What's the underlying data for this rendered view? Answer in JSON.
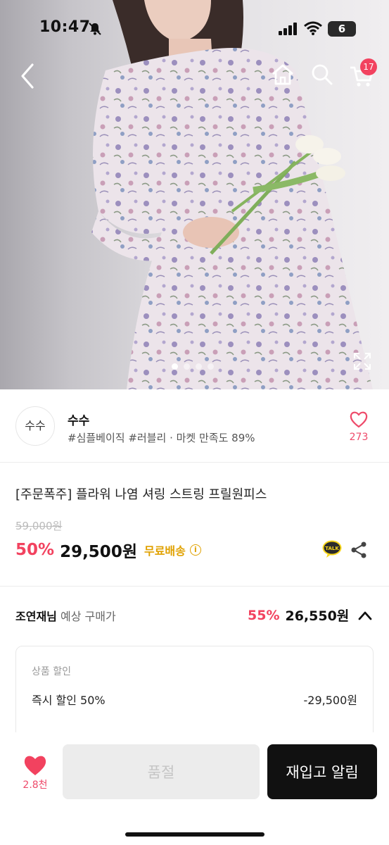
{
  "status_bar": {
    "time": "10:47",
    "battery": "6"
  },
  "nav": {
    "cart_count": "17"
  },
  "store": {
    "logo_text": "수수",
    "name": "수수",
    "tags": "#심플베이직 #러블리 · 마켓 만족도 89%",
    "like_count": "273"
  },
  "product": {
    "title": "[주문폭주] 플라워 나염 셔링 스트링 프릴원피스",
    "original_price": "59,000원",
    "discount": "50%",
    "price": "29,500원",
    "shipping": "무료배송"
  },
  "member_price": {
    "name": "조연재님",
    "label": " 예상 구매가",
    "discount": "55%",
    "price": "26,550원"
  },
  "discount_details": {
    "title": "상품 할인",
    "item_label": "즉시 할인 50%",
    "item_amount": "-29,500원"
  },
  "bottom_bar": {
    "wish_count": "2.8천",
    "soldout_label": "품절",
    "restock_label": "재입고 알림"
  },
  "image_carousel": {
    "count": 4,
    "active_index": 0
  },
  "colors": {
    "accent": "#f2425f",
    "shipping": "#e0a100",
    "dark_button": "#111111"
  }
}
